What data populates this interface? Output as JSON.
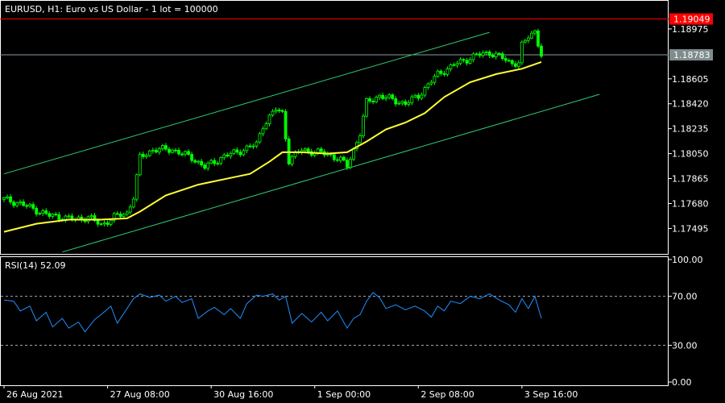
{
  "colors": {
    "background": "#000000",
    "frame": "#ffffff",
    "candle": "#00ff00",
    "moving_average": "#ffff33",
    "channel": "#2ecc71",
    "rsi": "#1e90ff",
    "level_line_red": "#ff0000",
    "level_line_grey": "#8c9aa8",
    "high_tag": "#ff0000",
    "bid_tag": "#7f8c8d"
  },
  "chart_data": [
    {
      "type": "candlestick",
      "title": "EURUSD, H1:  Euro vs US Dollar - 1 lot = 100000",
      "y_ticks": [
        "1.18975",
        "1.18605",
        "1.18420",
        "1.18235",
        "1.18050",
        "1.17865",
        "1.17680",
        "1.17495"
      ],
      "ylim": [
        1.1733,
        1.1916
      ],
      "price_tags": [
        {
          "label": "1.19049",
          "value": 1.19049,
          "color": "red"
        },
        {
          "label": "1.18783",
          "value": 1.18783,
          "color": "grey"
        }
      ],
      "x_ticks": [
        {
          "label": "26 Aug 2021",
          "bar": 0
        },
        {
          "label": "27 Aug 08:00",
          "bar": 32
        },
        {
          "label": "30 Aug 16:00",
          "bar": 64
        },
        {
          "label": "1 Sep 00:00",
          "bar": 96
        },
        {
          "label": "2 Sep 08:00",
          "bar": 128
        },
        {
          "label": "3 Sep 16:00",
          "bar": 160
        }
      ],
      "bar_count": 167,
      "price_path": [
        [
          0,
          1.1771
        ],
        [
          5,
          1.1768
        ],
        [
          10,
          1.1763
        ],
        [
          14,
          1.1759
        ],
        [
          18,
          1.1758
        ],
        [
          22,
          1.1756
        ],
        [
          26,
          1.1758
        ],
        [
          30,
          1.1752
        ],
        [
          34,
          1.1758
        ],
        [
          38,
          1.1761
        ],
        [
          40,
          1.1773
        ],
        [
          42,
          1.1802
        ],
        [
          46,
          1.1808
        ],
        [
          52,
          1.1808
        ],
        [
          58,
          1.1802
        ],
        [
          62,
          1.1795
        ],
        [
          68,
          1.1803
        ],
        [
          74,
          1.1808
        ],
        [
          78,
          1.1812
        ],
        [
          80,
          1.1826
        ],
        [
          84,
          1.1838
        ],
        [
          86,
          1.1835
        ],
        [
          88,
          1.18
        ],
        [
          92,
          1.1808
        ],
        [
          96,
          1.1806
        ],
        [
          100,
          1.1805
        ],
        [
          104,
          1.18
        ],
        [
          106,
          1.1796
        ],
        [
          110,
          1.182
        ],
        [
          112,
          1.1843
        ],
        [
          116,
          1.1848
        ],
        [
          120,
          1.1845
        ],
        [
          124,
          1.1842
        ],
        [
          128,
          1.1848
        ],
        [
          134,
          1.1864
        ],
        [
          140,
          1.1872
        ],
        [
          146,
          1.1878
        ],
        [
          150,
          1.188
        ],
        [
          154,
          1.1876
        ],
        [
          156,
          1.1873
        ],
        [
          159,
          1.1872
        ],
        [
          160,
          1.1885
        ],
        [
          162,
          1.1892
        ],
        [
          164,
          1.1896
        ],
        [
          166,
          1.1878
        ]
      ],
      "moving_average_path": [
        [
          0,
          1.1747
        ],
        [
          10,
          1.1753
        ],
        [
          20,
          1.1756
        ],
        [
          30,
          1.1756
        ],
        [
          38,
          1.1757
        ],
        [
          42,
          1.1762
        ],
        [
          50,
          1.1774
        ],
        [
          60,
          1.1782
        ],
        [
          70,
          1.1787
        ],
        [
          76,
          1.179
        ],
        [
          82,
          1.1799
        ],
        [
          86,
          1.1806
        ],
        [
          92,
          1.1806
        ],
        [
          100,
          1.1805
        ],
        [
          106,
          1.1806
        ],
        [
          112,
          1.1814
        ],
        [
          118,
          1.1823
        ],
        [
          124,
          1.1828
        ],
        [
          130,
          1.1835
        ],
        [
          136,
          1.1847
        ],
        [
          144,
          1.1858
        ],
        [
          152,
          1.1864
        ],
        [
          160,
          1.1868
        ],
        [
          166,
          1.1873
        ]
      ],
      "channel_lines": [
        {
          "from": [
            0,
            1.179
          ],
          "to": [
            150,
            1.1895
          ]
        },
        {
          "from": [
            18,
            1.1732
          ],
          "to": [
            184,
            1.1849
          ]
        }
      ]
    },
    {
      "type": "line",
      "title": "RSI(14) 52.09",
      "y_ticks": [
        "100.00",
        "70.00",
        "30.00",
        "0.00"
      ],
      "ylim": [
        0,
        100
      ],
      "levels": [
        70,
        30
      ],
      "values": [
        [
          0,
          67
        ],
        [
          3,
          66
        ],
        [
          5,
          58
        ],
        [
          8,
          62
        ],
        [
          10,
          50
        ],
        [
          13,
          57
        ],
        [
          15,
          45
        ],
        [
          18,
          52
        ],
        [
          20,
          44
        ],
        [
          23,
          49
        ],
        [
          25,
          41
        ],
        [
          28,
          51
        ],
        [
          30,
          55
        ],
        [
          33,
          62
        ],
        [
          35,
          48
        ],
        [
          38,
          60
        ],
        [
          40,
          68
        ],
        [
          42,
          72
        ],
        [
          45,
          69
        ],
        [
          48,
          71
        ],
        [
          50,
          66
        ],
        [
          53,
          70
        ],
        [
          55,
          65
        ],
        [
          58,
          68
        ],
        [
          60,
          52
        ],
        [
          63,
          58
        ],
        [
          65,
          61
        ],
        [
          68,
          55
        ],
        [
          70,
          60
        ],
        [
          73,
          52
        ],
        [
          75,
          64
        ],
        [
          78,
          71
        ],
        [
          80,
          70
        ],
        [
          83,
          72
        ],
        [
          85,
          67
        ],
        [
          87,
          70
        ],
        [
          89,
          48
        ],
        [
          92,
          56
        ],
        [
          95,
          49
        ],
        [
          98,
          57
        ],
        [
          100,
          50
        ],
        [
          103,
          58
        ],
        [
          106,
          44
        ],
        [
          108,
          52
        ],
        [
          110,
          55
        ],
        [
          112,
          66
        ],
        [
          114,
          73
        ],
        [
          116,
          69
        ],
        [
          118,
          60
        ],
        [
          121,
          63
        ],
        [
          124,
          59
        ],
        [
          127,
          62
        ],
        [
          130,
          58
        ],
        [
          132,
          53
        ],
        [
          134,
          62
        ],
        [
          136,
          58
        ],
        [
          138,
          66
        ],
        [
          141,
          64
        ],
        [
          144,
          70
        ],
        [
          147,
          68
        ],
        [
          150,
          72
        ],
        [
          153,
          67
        ],
        [
          156,
          63
        ],
        [
          158,
          57
        ],
        [
          160,
          68
        ],
        [
          162,
          60
        ],
        [
          164,
          70
        ],
        [
          166,
          52
        ]
      ]
    }
  ]
}
